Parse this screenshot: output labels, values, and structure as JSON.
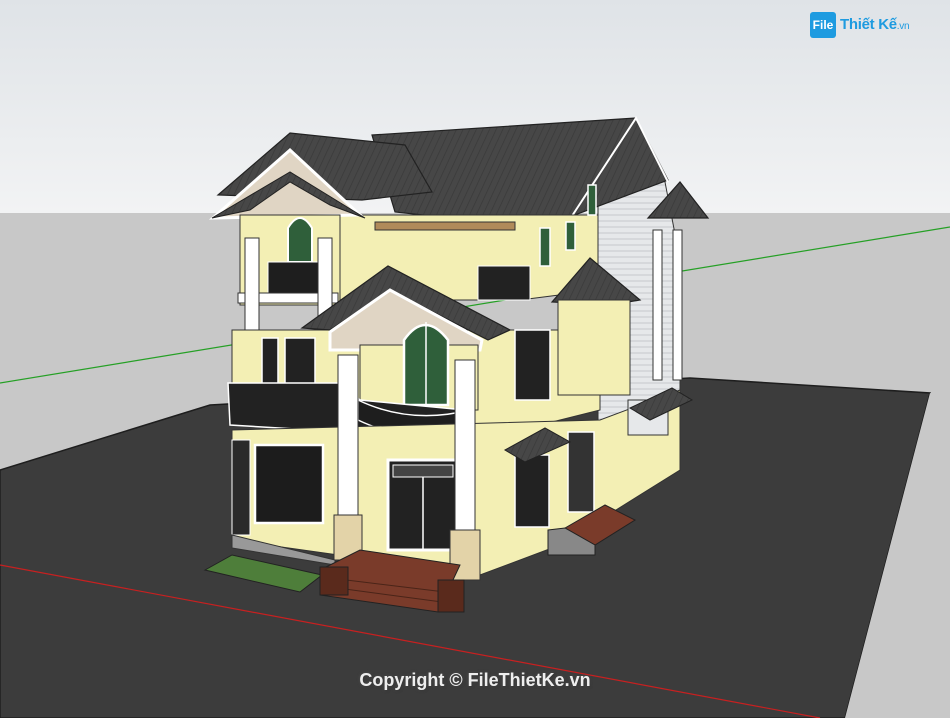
{
  "watermark": {
    "logo_mark": "File",
    "logo_name": "Thiết Kế",
    "logo_domain": ".vn",
    "copyright": "Copyright © FileThietKe.vn"
  },
  "colors": {
    "sky": "#e8ebee",
    "ground": "#c9c9c9",
    "pavement": "#3d3d3d",
    "roof": "#4a4a4a",
    "wall": "#f4f1b8",
    "trim": "#ffffff",
    "accent": "#1e9be0",
    "axis_red": "#d02020",
    "axis_green": "#20a020"
  }
}
